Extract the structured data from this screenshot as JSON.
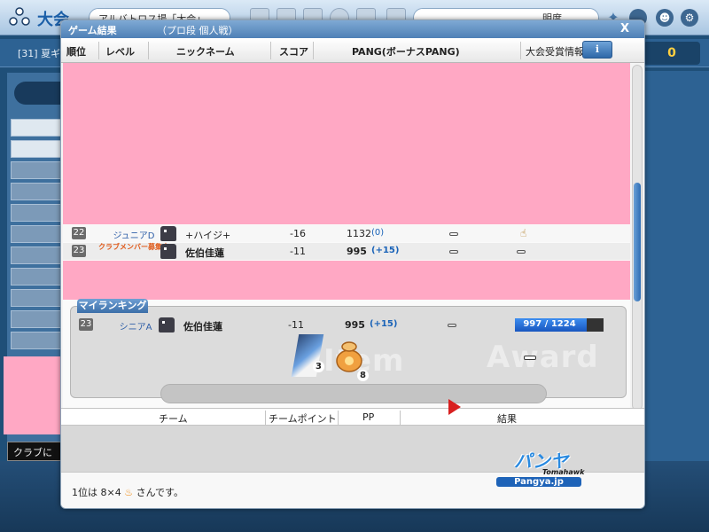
{
  "background": {
    "app_name": "大会",
    "room_text": "アルバトロス場「大会」",
    "search_label": "明度",
    "room_number": "[31] 夏ギ",
    "points": "0",
    "club_chat": "クラブに"
  },
  "dialog": {
    "title": "ゲーム結果",
    "subtitle": "（プロ段 個人戦）",
    "close": "X",
    "columns": {
      "rank": "順位",
      "level": "レベル",
      "nickname": "ニックネーム",
      "score": "スコア",
      "pang": "PANG(ボーナスPANG)",
      "award_info": "大会受賞情報",
      "info_button": "i"
    },
    "rows": [
      {
        "rank": "22",
        "level": "ジュニアD",
        "nickname": "+ハイジ+",
        "score": "-16",
        "pang": "1132",
        "bonus": "(0)"
      },
      {
        "rank": "23",
        "level": "クラブメンバー募集中",
        "nickname": "佐伯佳蓮",
        "score": "-11",
        "pang": "995",
        "bonus": "(+15)"
      }
    ],
    "my_ranking": {
      "tab": "マイランキング",
      "rank": "23",
      "level": "シニアA",
      "nickname": "佐伯佳蓮",
      "score": "-11",
      "pang": "995",
      "bonus": "(+15)",
      "exp_text": "997 / 1224",
      "exp_fraction": 0.8145,
      "watermark_left": "Item",
      "watermark_right": "Award",
      "item_card_count": "3",
      "item_bag_count": "8"
    },
    "team_columns": {
      "team": "チーム",
      "team_points": "チームポイント",
      "pp": "PP",
      "result": "結果"
    },
    "footer": {
      "prefix": "1位は 8×4",
      "suffix": "さんです。"
    },
    "logo": {
      "main": "パンヤ",
      "sub": "Tomahawk",
      "site": "Pangya.jp"
    }
  }
}
